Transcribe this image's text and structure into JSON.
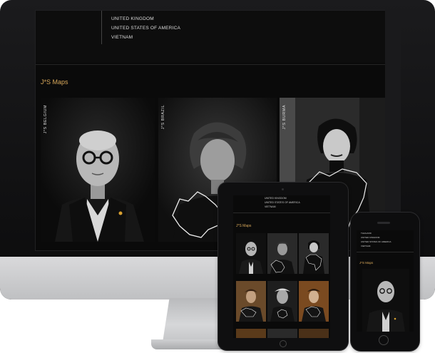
{
  "countries": [
    "UNITED KINGDOM",
    "UNITED STATES OF AMERICA",
    "VIETNAM"
  ],
  "section_title": "J*S Maps",
  "cards": [
    {
      "label": "J*S   BELGIUM"
    },
    {
      "label": "J*S   BRAZIL"
    },
    {
      "label": "J*S   BURMA"
    }
  ],
  "ipad": {
    "countries": [
      "UNITED KINGDOM",
      "UNITED STATES OF AMERICA",
      "VIETNAM"
    ],
    "section_title": "J*S Maps"
  },
  "phone": {
    "countries": [
      "THAILAND",
      "UNITED KINGDOM",
      "UNITED STATES OF AMERICA",
      "VIETNAM"
    ],
    "section_title": "J*S Maps"
  },
  "colors": {
    "accent": "#d8a85a",
    "screen_bg": "#0a0a0a",
    "device_silver": "#c8c9cb"
  }
}
